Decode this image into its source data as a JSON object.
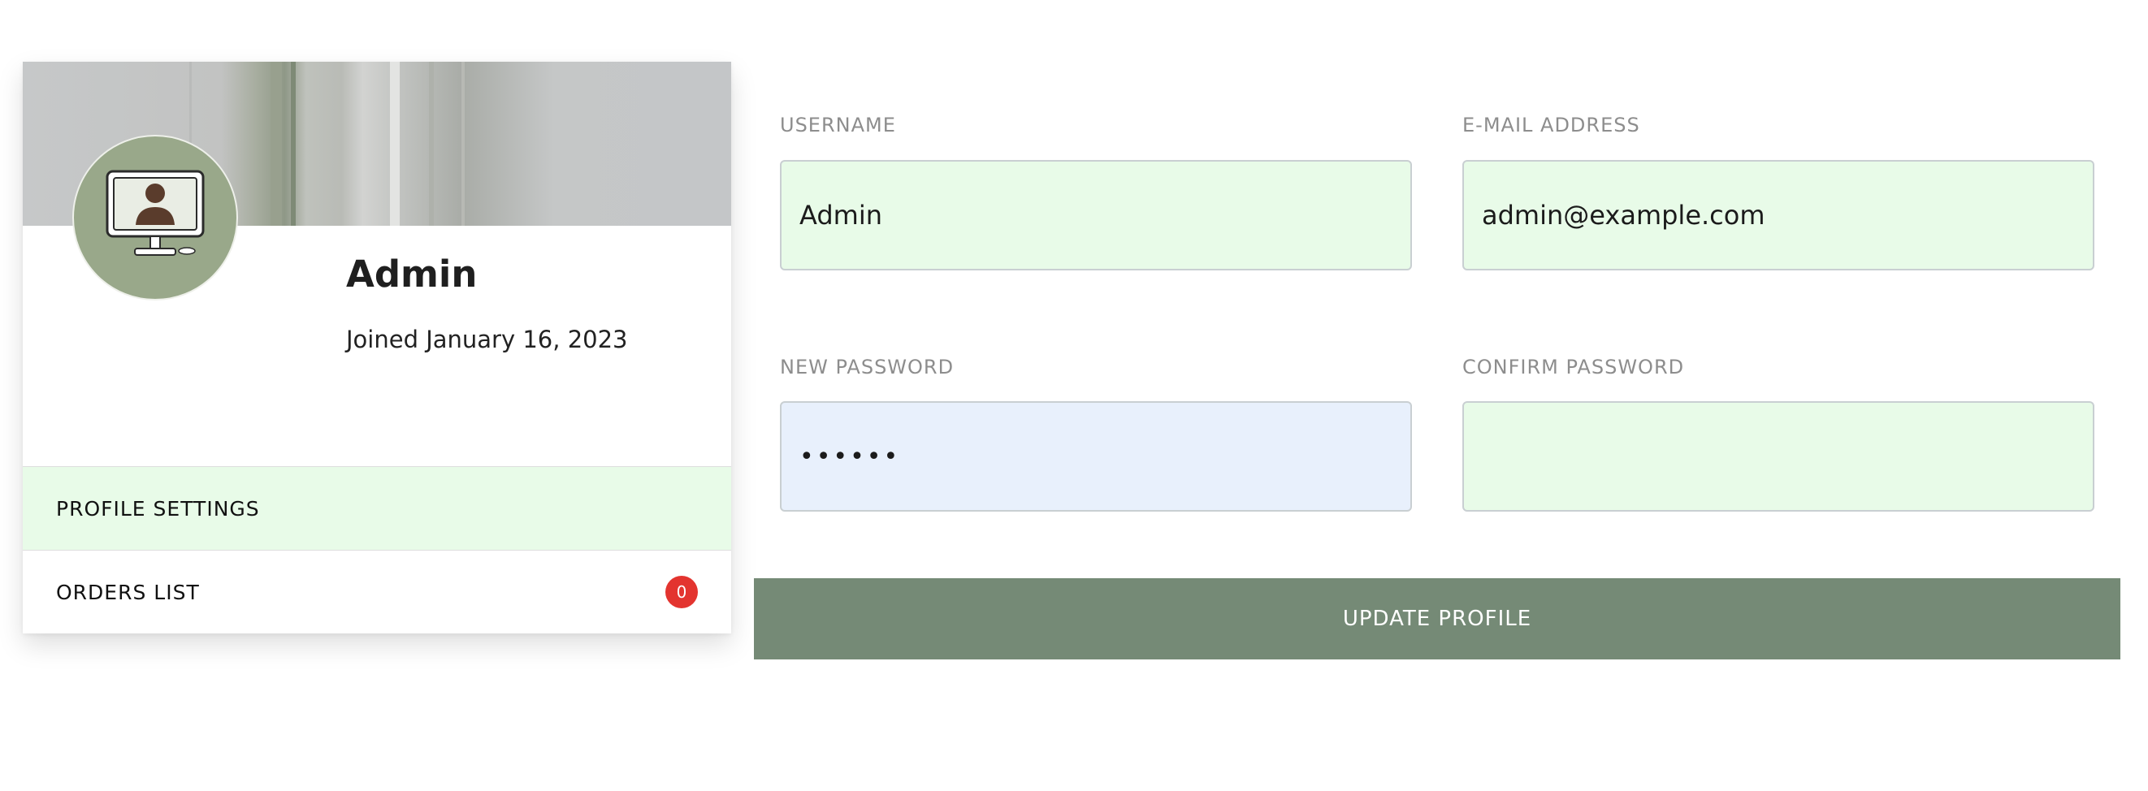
{
  "profile": {
    "name": "Admin",
    "joined": "Joined January 16, 2023",
    "avatar_icon": "user-monitor-icon"
  },
  "menu": {
    "items": [
      {
        "label": "PROFILE SETTINGS",
        "active": true
      },
      {
        "label": "ORDERS LIST",
        "badge": "0"
      }
    ]
  },
  "form": {
    "username": {
      "label": "USERNAME",
      "value": "Admin"
    },
    "email": {
      "label": "E-MAIL ADDRESS",
      "value": "admin@example.com"
    },
    "new_password": {
      "label": "NEW PASSWORD",
      "value": "••••••"
    },
    "confirm_password": {
      "label": "CONFIRM PASSWORD",
      "value": ""
    },
    "submit_label": "UPDATE PROFILE"
  },
  "colors": {
    "accent": "#758a76",
    "field_bg": "#e8fbe8",
    "active_field_bg": "#e8f0fc",
    "badge": "#e3342f",
    "avatar_bg": "#99a88a"
  }
}
